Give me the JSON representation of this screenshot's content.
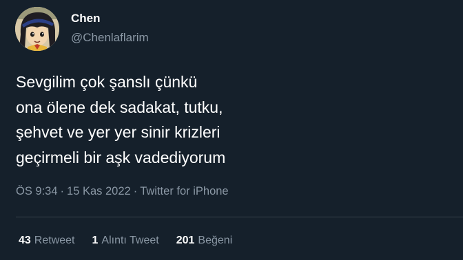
{
  "user": {
    "display_name": "Chen",
    "handle": "@Chenlaflarim",
    "avatar_icon": "cartoon-avatar"
  },
  "tweet": {
    "lines": [
      "Sevgilim çok şanslı çünkü",
      "ona ölene dek sadakat, tutku,",
      "şehvet ve yer yer sinir krizleri",
      "geçirmeli bir aşk vadediyorum"
    ]
  },
  "meta": {
    "time": "ÖS 9:34",
    "separator": "·",
    "date": "15 Kas 2022",
    "source": "Twitter for iPhone"
  },
  "stats": {
    "retweets": {
      "count": "43",
      "label": "Retweet"
    },
    "quotes": {
      "count": "1",
      "label": "Alıntı Tweet"
    },
    "likes": {
      "count": "201",
      "label": "Beğeni"
    }
  },
  "colors": {
    "background": "#15202b",
    "text_primary": "#ffffff",
    "text_secondary": "#8b98a5",
    "divider": "#38444d"
  }
}
